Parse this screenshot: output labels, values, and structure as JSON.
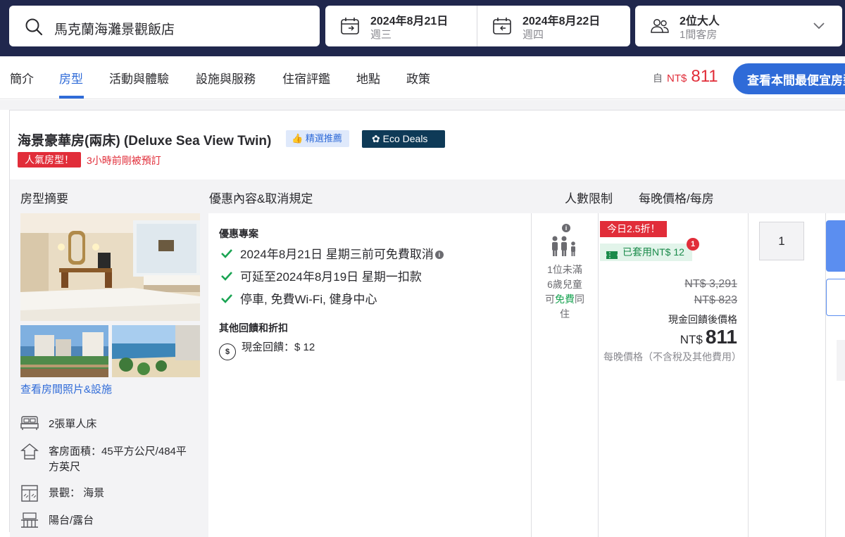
{
  "search": {
    "query": "馬克蘭海灘景觀飯店",
    "checkin_date": "2024年8月21日",
    "checkin_weekday": "週三",
    "checkout_date": "2024年8月22日",
    "checkout_weekday": "週四",
    "adults": "2位大人",
    "rooms": "1間客房"
  },
  "nav": {
    "tabs": [
      "簡介",
      "房型",
      "活動與體驗",
      "設施與服務",
      "住宿評鑑",
      "地點",
      "政策"
    ],
    "active_tab": "房型",
    "from_label": "自",
    "currency": "NT$",
    "from_price": "811",
    "cheapest_button": "查看本間最便宜房型"
  },
  "room": {
    "title": "海景豪華房(兩床) (Deluxe Sea View Twin)",
    "recommended": "精選推薦",
    "eco": "Eco Deals",
    "popular": "人氣房型！",
    "booked": "3小時前剛被預訂"
  },
  "columns": {
    "summary": "房型摘要",
    "deals": "優惠內容&取消規定",
    "occupancy": "人數限制",
    "price": "每晚價格/每房"
  },
  "left": {
    "photos_link": "查看房間照片&設施",
    "amenities": [
      {
        "icon": "bed-icon",
        "text": "2張單人床"
      },
      {
        "icon": "room-size-icon",
        "text": "客房面積：45平方公尺/484平方英尺"
      },
      {
        "icon": "view-icon",
        "text": "景觀： 海景"
      },
      {
        "icon": "balcony-icon",
        "text": "陽台/露台"
      }
    ]
  },
  "deals": {
    "heading": "優惠專案",
    "benefits": [
      "2024年8月21日 星期三前可免費取消",
      "可延至2024年8月19日 星期一扣款",
      "停車, 免費Wi-Fi, 健身中心"
    ],
    "other_heading": "其他回饋和折扣",
    "cashback": "現金回饋：$ 12"
  },
  "occupancy": {
    "line1": "1位未滿",
    "line2": "6歲兒童",
    "line3_pre": "可",
    "line3_free": "免費",
    "line3_post": "同",
    "line4": "住"
  },
  "price": {
    "today": "今日2.5折！",
    "applied": "已套用NT$ 12",
    "badge": "1",
    "original1": "NT$ 3,291",
    "original2": "NT$ 823",
    "after_label": "現金回饋後價格",
    "currency": "NT$",
    "final": "811",
    "per_night_note": "每晚價格（不含稅及其他費用）"
  },
  "qty": {
    "value": "1"
  },
  "colors": {
    "navy": "#20274d",
    "accent_blue": "#2f6bd8",
    "red": "#e12d39",
    "eco": "#0e3a57",
    "green": "#1aa453"
  }
}
